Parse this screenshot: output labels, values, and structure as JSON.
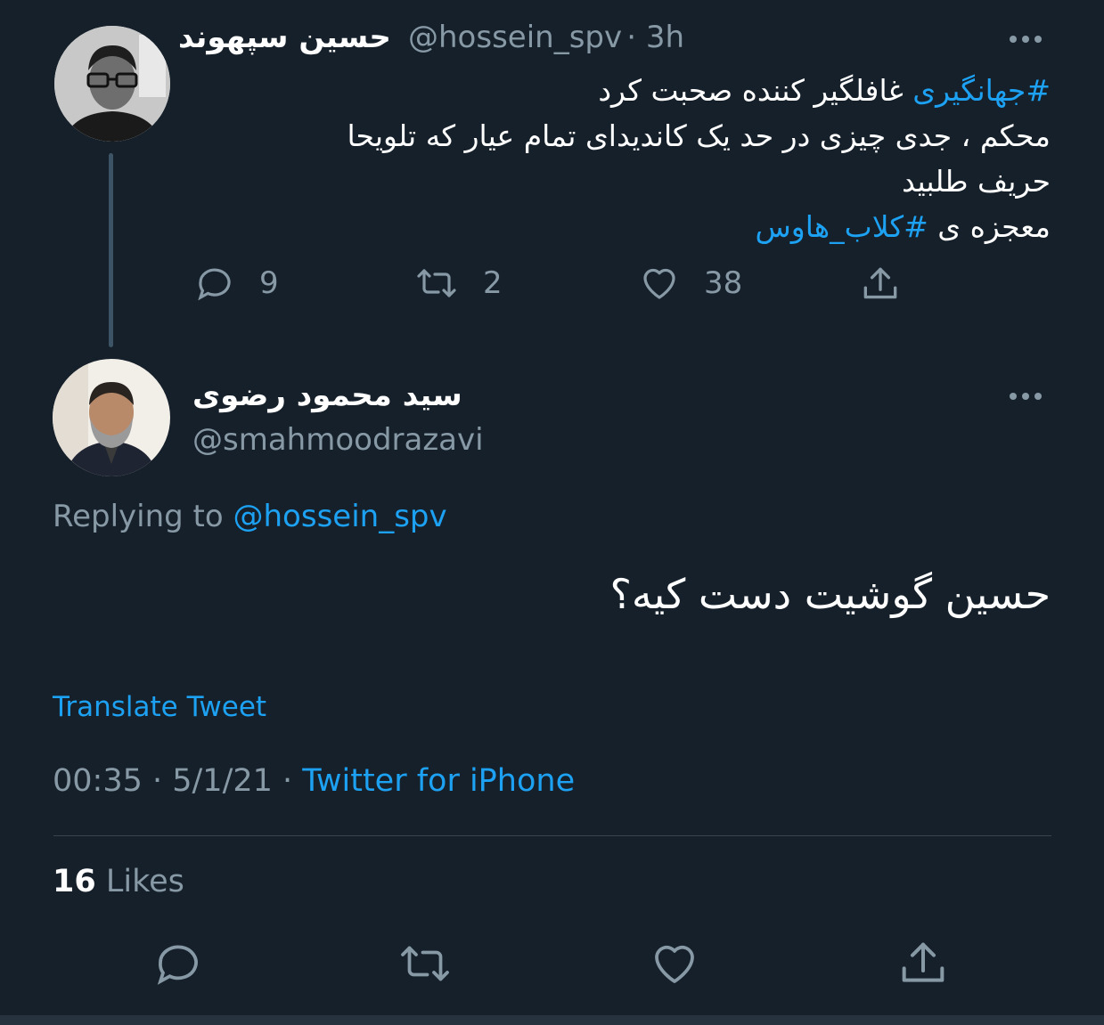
{
  "parent_tweet": {
    "display_name": "حسین سپهوند",
    "handle": "@hossein_spv",
    "time": "· 3h",
    "lines": [
      {
        "hashtag": "#جهانگیری",
        "text": " غافلگیر کننده صحبت کرد"
      },
      {
        "text": "محکم ، جدی چیزی در حد یک کاندیدای تمام عیار که تلویحا"
      },
      {
        "text": "حریف طلبید"
      },
      {
        "text": "معجزه ی ",
        "hashtag": "#کلاب_هاوس"
      }
    ],
    "actions": {
      "replies": "9",
      "retweets": "2",
      "likes": "38"
    },
    "avatar_icon": "person-avatar"
  },
  "main_tweet": {
    "display_name": "سید محمود رضوی",
    "handle": "@smahmoodrazavi",
    "replying_prefix": "Replying to ",
    "replying_handle": "@hossein_spv",
    "text": "حسین گوشیت دست کیه؟",
    "translate_label": "Translate Tweet",
    "timestamp": "00:35 · 5/1/21 · ",
    "source": "Twitter for iPhone",
    "likes_count": "16",
    "likes_label": " Likes",
    "avatar_icon": "person-avatar"
  },
  "icons": [
    "more-icon",
    "reply-icon",
    "retweet-icon",
    "like-icon",
    "share-icon"
  ],
  "colors": {
    "background": "#15202b",
    "accent": "#1da1f2",
    "muted": "#8899a6",
    "divider": "#38444d"
  }
}
